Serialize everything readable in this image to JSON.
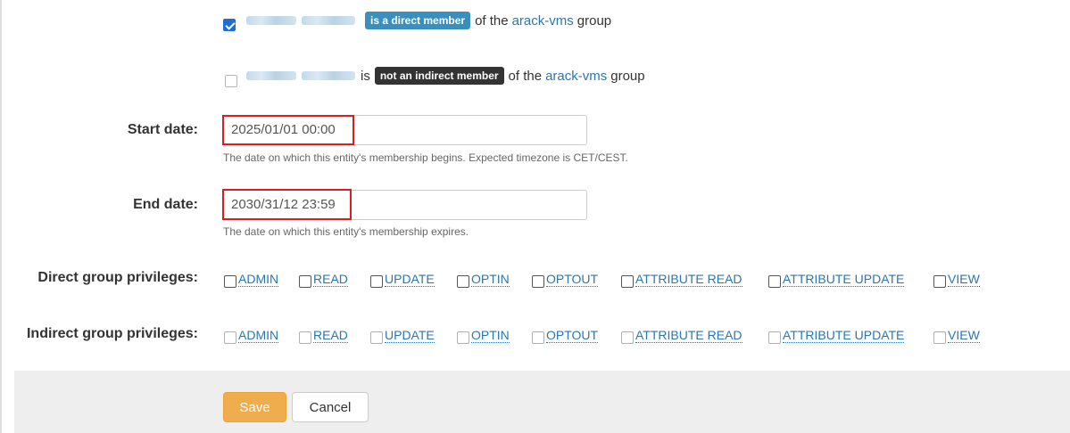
{
  "direct_membership": {
    "checked": true,
    "badge": "is a direct member",
    "pre_text": "",
    "of_text": "of the",
    "group": "arack-vms",
    "suffix": "group"
  },
  "indirect_membership": {
    "checked": false,
    "pre_text": "is",
    "badge": "not an indirect member",
    "of_text": "of the",
    "group": "arack-vms",
    "suffix": "group"
  },
  "start_date": {
    "label": "Start date:",
    "value": "2025/01/01 00:00",
    "help": "The date on which this entity's membership begins. Expected timezone is CET/CEST."
  },
  "end_date": {
    "label": "End date:",
    "value": "2030/31/12 23:59",
    "help": "The date on which this entity's membership expires."
  },
  "direct_privileges": {
    "label": "Direct group privileges:",
    "items": [
      "ADMIN",
      "READ",
      "UPDATE",
      "OPTIN",
      "OPTOUT",
      "ATTRIBUTE READ",
      "ATTRIBUTE UPDATE",
      "VIEW"
    ]
  },
  "indirect_privileges": {
    "label": "Indirect group privileges:",
    "items": [
      "ADMIN",
      "READ",
      "UPDATE",
      "OPTIN",
      "OPTOUT",
      "ATTRIBUTE READ",
      "ATTRIBUTE UPDATE",
      "VIEW"
    ]
  },
  "buttons": {
    "save": "Save",
    "cancel": "Cancel"
  },
  "colors": {
    "link": "#2a77b0",
    "direct_badge": "#3a8fbd",
    "indirect_badge": "#333333",
    "save": "#f0ad4e",
    "highlight": "#d81e1e"
  }
}
